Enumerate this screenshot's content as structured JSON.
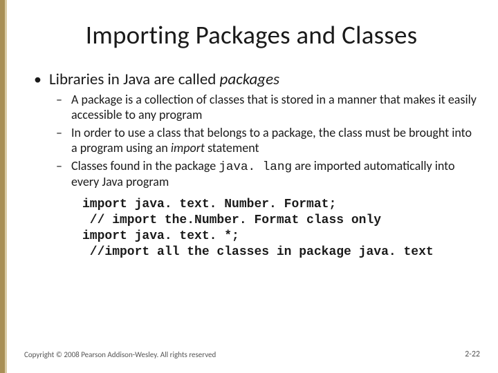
{
  "title": "Importing Packages and Classes",
  "bullets": {
    "l1_0_pre": "Libraries in Java are called ",
    "l1_0_em": "packages",
    "l2_0": "A package is a collection of classes that is stored in a manner that makes it easily accessible to any program",
    "l2_1_pre": "In order to use a class that belongs to a package,  the class must be brought into a program using an ",
    "l2_1_em": "import",
    "l2_1_post": " statement",
    "l2_2_pre": "Classes found in the package ",
    "l2_2_code": "java. lang",
    "l2_2_post": " are imported automatically into every Java program"
  },
  "code": "import java. text. Number. Format;\n // import the.Number. Format class only\nimport java. text. *;\n //import all the classes in package java. text",
  "footer": "Copyright © 2008 Pearson Addison-Wesley. All rights reserved",
  "pagenum": "2-22"
}
